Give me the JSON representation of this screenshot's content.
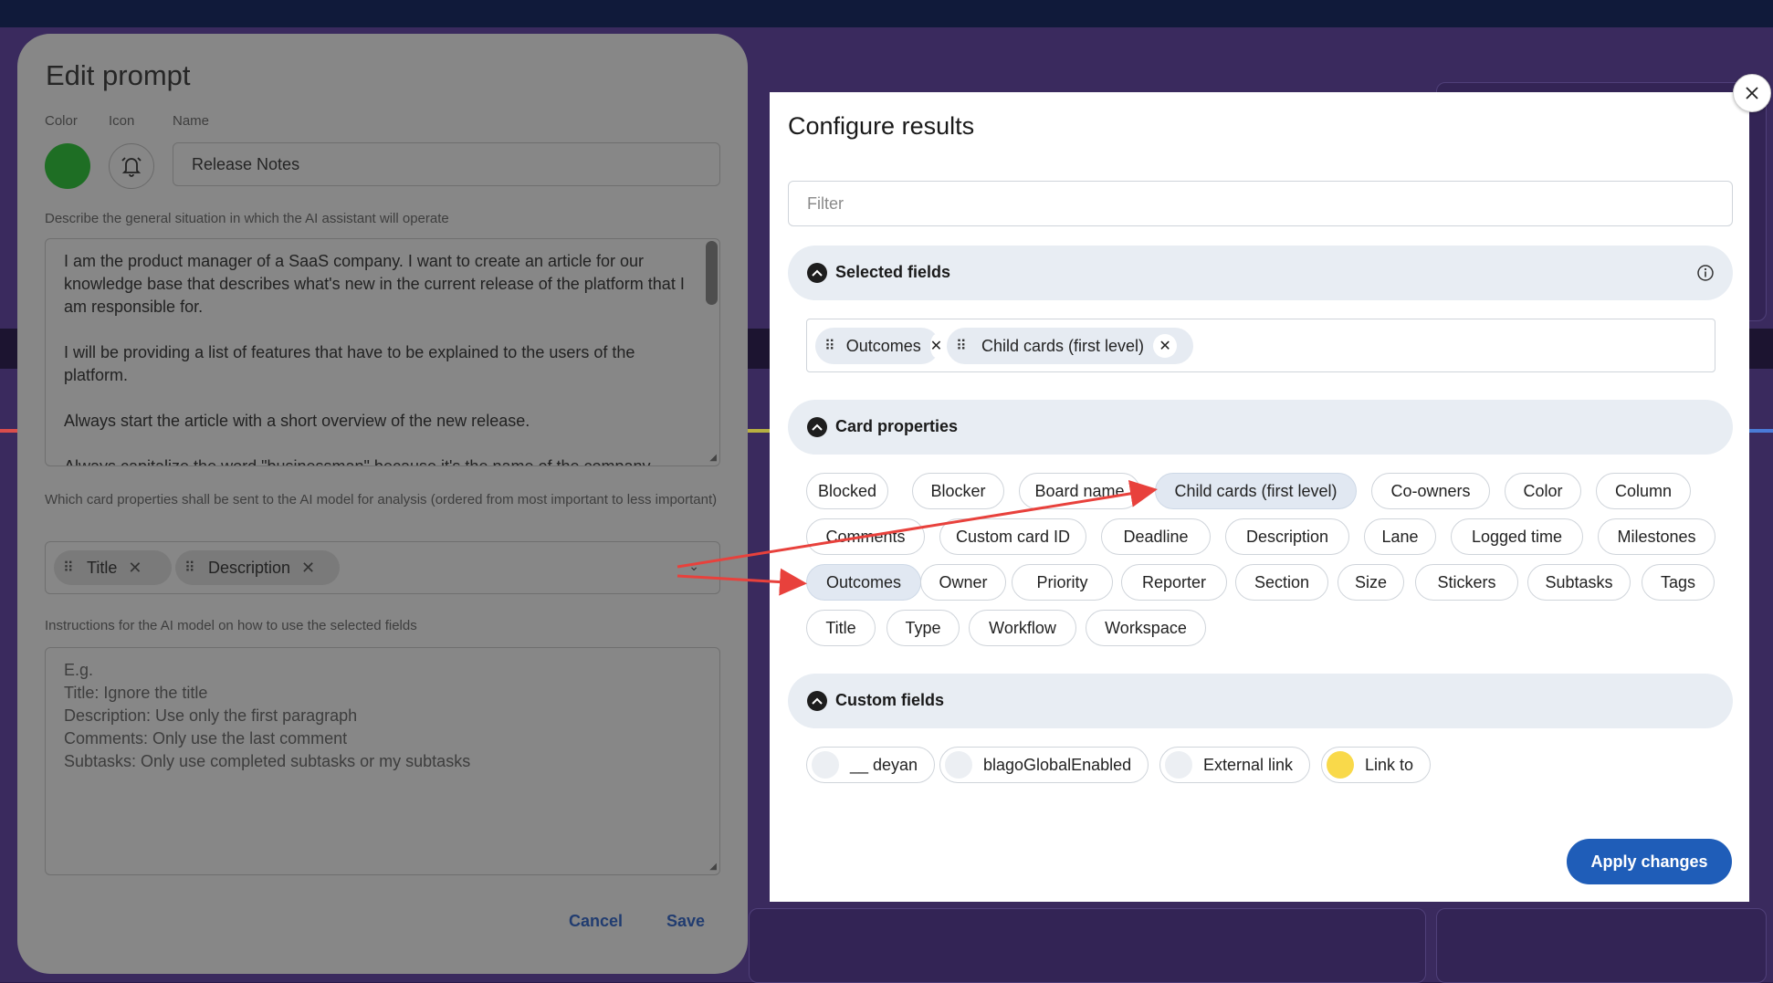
{
  "edit_prompt": {
    "title": "Edit prompt",
    "labels": {
      "color": "Color",
      "icon": "Icon",
      "name": "Name"
    },
    "icon_name": "bell-icon",
    "color_value": "#1e6e24",
    "name_value": "Release Notes",
    "situation_label": "Describe the general situation in which the AI assistant will operate",
    "situation_paragraphs": [
      "I am the product manager of a SaaS company. I want to create an article for our knowledge base that describes what's new in the current release of the platform that I am responsible for.",
      "I will be providing a list of features that have to be explained to the users of the platform.",
      "Always start the article with a short overview of the new release.",
      "Always capitalize the word \"businessman\" because it's the name of the company"
    ],
    "properties_label": "Which card properties shall be sent to the AI model for analysis (ordered from most important to less important)",
    "selected_properties": [
      "Title",
      "Description"
    ],
    "instructions_label": "Instructions for the AI model on how to use the selected fields",
    "instructions_placeholder": "E.g.\nTitle: Ignore the title\nDescription: Use only the first paragraph\nComments: Only use the last comment\nSubtasks: Only use completed subtasks or my subtasks",
    "cancel_label": "Cancel",
    "save_label": "Save"
  },
  "configure_results": {
    "title": "Configure results",
    "filter_placeholder": "Filter",
    "selected_fields": {
      "label": "Selected fields",
      "items": [
        "Outcomes",
        "Child cards (first level)"
      ]
    },
    "card_properties": {
      "label": "Card properties",
      "items": [
        "Blocked",
        "Blocker",
        "Board name",
        "Child cards (first level)",
        "Co-owners",
        "Color",
        "Column",
        "Comments",
        "Custom card ID",
        "Deadline",
        "Description",
        "Lane",
        "Logged time",
        "Milestones",
        "Outcomes",
        "Owner",
        "Priority",
        "Reporter",
        "Section",
        "Size",
        "Stickers",
        "Subtasks",
        "Tags",
        "Title",
        "Type",
        "Workflow",
        "Workspace"
      ]
    },
    "custom_fields": {
      "label": "Custom fields",
      "items": [
        {
          "label": "__ deyan",
          "color": "#eceff3"
        },
        {
          "label": "blagoGlobalEnabled",
          "color": "#eceff3"
        },
        {
          "label": "External link",
          "color": "#eceff3"
        },
        {
          "label": "Link to",
          "color": "#f9d94a"
        }
      ]
    },
    "apply_label": "Apply changes",
    "accent_color": "#1f5db8",
    "annotation_color": "#e8413c"
  }
}
